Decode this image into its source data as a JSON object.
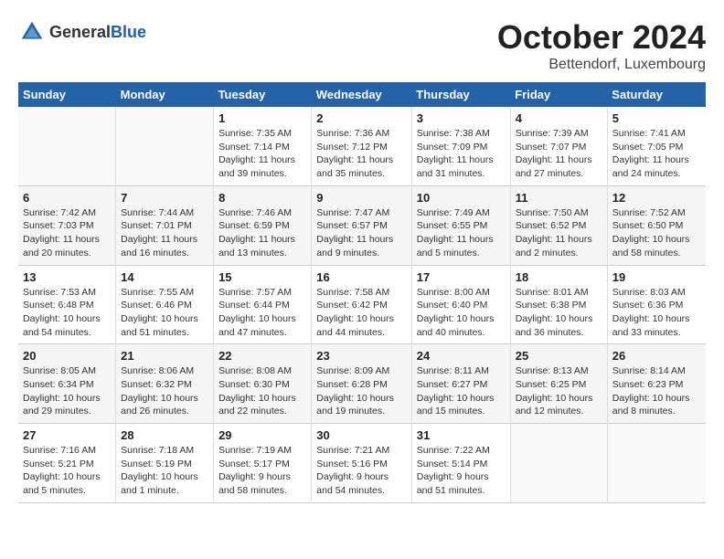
{
  "header": {
    "logo_general": "General",
    "logo_blue": "Blue",
    "month": "October 2024",
    "location": "Bettendorf, Luxembourg"
  },
  "weekdays": [
    "Sunday",
    "Monday",
    "Tuesday",
    "Wednesday",
    "Thursday",
    "Friday",
    "Saturday"
  ],
  "weeks": [
    [
      {
        "day": "",
        "detail": ""
      },
      {
        "day": "",
        "detail": ""
      },
      {
        "day": "1",
        "detail": "Sunrise: 7:35 AM\nSunset: 7:14 PM\nDaylight: 11 hours and 39 minutes."
      },
      {
        "day": "2",
        "detail": "Sunrise: 7:36 AM\nSunset: 7:12 PM\nDaylight: 11 hours and 35 minutes."
      },
      {
        "day": "3",
        "detail": "Sunrise: 7:38 AM\nSunset: 7:09 PM\nDaylight: 11 hours and 31 minutes."
      },
      {
        "day": "4",
        "detail": "Sunrise: 7:39 AM\nSunset: 7:07 PM\nDaylight: 11 hours and 27 minutes."
      },
      {
        "day": "5",
        "detail": "Sunrise: 7:41 AM\nSunset: 7:05 PM\nDaylight: 11 hours and 24 minutes."
      }
    ],
    [
      {
        "day": "6",
        "detail": "Sunrise: 7:42 AM\nSunset: 7:03 PM\nDaylight: 11 hours and 20 minutes."
      },
      {
        "day": "7",
        "detail": "Sunrise: 7:44 AM\nSunset: 7:01 PM\nDaylight: 11 hours and 16 minutes."
      },
      {
        "day": "8",
        "detail": "Sunrise: 7:46 AM\nSunset: 6:59 PM\nDaylight: 11 hours and 13 minutes."
      },
      {
        "day": "9",
        "detail": "Sunrise: 7:47 AM\nSunset: 6:57 PM\nDaylight: 11 hours and 9 minutes."
      },
      {
        "day": "10",
        "detail": "Sunrise: 7:49 AM\nSunset: 6:55 PM\nDaylight: 11 hours and 5 minutes."
      },
      {
        "day": "11",
        "detail": "Sunrise: 7:50 AM\nSunset: 6:52 PM\nDaylight: 11 hours and 2 minutes."
      },
      {
        "day": "12",
        "detail": "Sunrise: 7:52 AM\nSunset: 6:50 PM\nDaylight: 10 hours and 58 minutes."
      }
    ],
    [
      {
        "day": "13",
        "detail": "Sunrise: 7:53 AM\nSunset: 6:48 PM\nDaylight: 10 hours and 54 minutes."
      },
      {
        "day": "14",
        "detail": "Sunrise: 7:55 AM\nSunset: 6:46 PM\nDaylight: 10 hours and 51 minutes."
      },
      {
        "day": "15",
        "detail": "Sunrise: 7:57 AM\nSunset: 6:44 PM\nDaylight: 10 hours and 47 minutes."
      },
      {
        "day": "16",
        "detail": "Sunrise: 7:58 AM\nSunset: 6:42 PM\nDaylight: 10 hours and 44 minutes."
      },
      {
        "day": "17",
        "detail": "Sunrise: 8:00 AM\nSunset: 6:40 PM\nDaylight: 10 hours and 40 minutes."
      },
      {
        "day": "18",
        "detail": "Sunrise: 8:01 AM\nSunset: 6:38 PM\nDaylight: 10 hours and 36 minutes."
      },
      {
        "day": "19",
        "detail": "Sunrise: 8:03 AM\nSunset: 6:36 PM\nDaylight: 10 hours and 33 minutes."
      }
    ],
    [
      {
        "day": "20",
        "detail": "Sunrise: 8:05 AM\nSunset: 6:34 PM\nDaylight: 10 hours and 29 minutes."
      },
      {
        "day": "21",
        "detail": "Sunrise: 8:06 AM\nSunset: 6:32 PM\nDaylight: 10 hours and 26 minutes."
      },
      {
        "day": "22",
        "detail": "Sunrise: 8:08 AM\nSunset: 6:30 PM\nDaylight: 10 hours and 22 minutes."
      },
      {
        "day": "23",
        "detail": "Sunrise: 8:09 AM\nSunset: 6:28 PM\nDaylight: 10 hours and 19 minutes."
      },
      {
        "day": "24",
        "detail": "Sunrise: 8:11 AM\nSunset: 6:27 PM\nDaylight: 10 hours and 15 minutes."
      },
      {
        "day": "25",
        "detail": "Sunrise: 8:13 AM\nSunset: 6:25 PM\nDaylight: 10 hours and 12 minutes."
      },
      {
        "day": "26",
        "detail": "Sunrise: 8:14 AM\nSunset: 6:23 PM\nDaylight: 10 hours and 8 minutes."
      }
    ],
    [
      {
        "day": "27",
        "detail": "Sunrise: 7:16 AM\nSunset: 5:21 PM\nDaylight: 10 hours and 5 minutes."
      },
      {
        "day": "28",
        "detail": "Sunrise: 7:18 AM\nSunset: 5:19 PM\nDaylight: 10 hours and 1 minute."
      },
      {
        "day": "29",
        "detail": "Sunrise: 7:19 AM\nSunset: 5:17 PM\nDaylight: 9 hours and 58 minutes."
      },
      {
        "day": "30",
        "detail": "Sunrise: 7:21 AM\nSunset: 5:16 PM\nDaylight: 9 hours and 54 minutes."
      },
      {
        "day": "31",
        "detail": "Sunrise: 7:22 AM\nSunset: 5:14 PM\nDaylight: 9 hours and 51 minutes."
      },
      {
        "day": "",
        "detail": ""
      },
      {
        "day": "",
        "detail": ""
      }
    ]
  ]
}
